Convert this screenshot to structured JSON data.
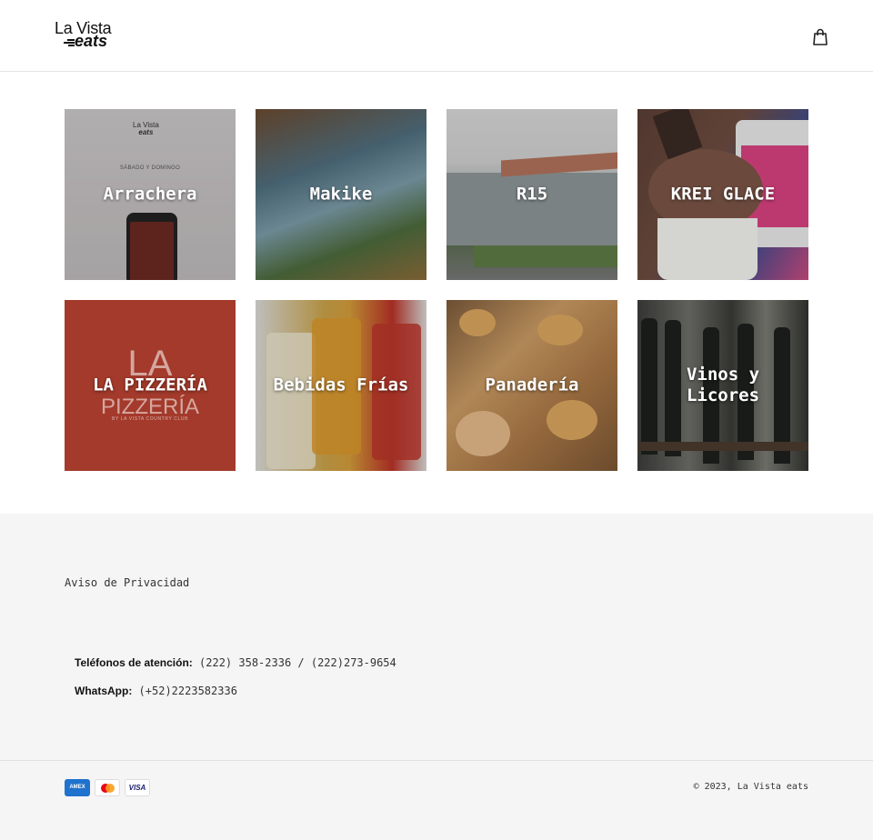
{
  "header": {
    "logo_top": "La Vista",
    "logo_bottom": "eats",
    "cart_icon": "shopping-bag-icon"
  },
  "collections": [
    {
      "label": "Arrachera",
      "art_top": "La Vista",
      "art_bottom": "eats",
      "art_sub": "SÁBADO Y DOMINGO"
    },
    {
      "label": "Makike"
    },
    {
      "label": "R15"
    },
    {
      "label": "KREI GLACE"
    },
    {
      "label": "LA PIZZERÍA",
      "art_la": "LA",
      "art_pizzeria": "PIZZERÍA",
      "art_tag": "BY LA VISTA COUNTRY CLUB"
    },
    {
      "label": "Bebidas Frías"
    },
    {
      "label": "Panadería"
    },
    {
      "label": "Vinos y\nLicores"
    }
  ],
  "footer": {
    "privacy_link": "Aviso de Privacidad",
    "phone_label": "Teléfonos de atención:",
    "phone_value": " (222) 358-2336 / (222)273-9654",
    "whatsapp_label": "WhatsApp:",
    "whatsapp_value": " (+52)2223582336",
    "payment_icons": [
      "amex-icon",
      "mastercard-icon",
      "visa-icon"
    ],
    "amex_text": "AMEX",
    "visa_text": "VISA",
    "copyright": "© 2023, La Vista eats"
  },
  "colors": {
    "footer_bg": "#f5f5f5",
    "pizzeria_red": "#a33a2b"
  }
}
